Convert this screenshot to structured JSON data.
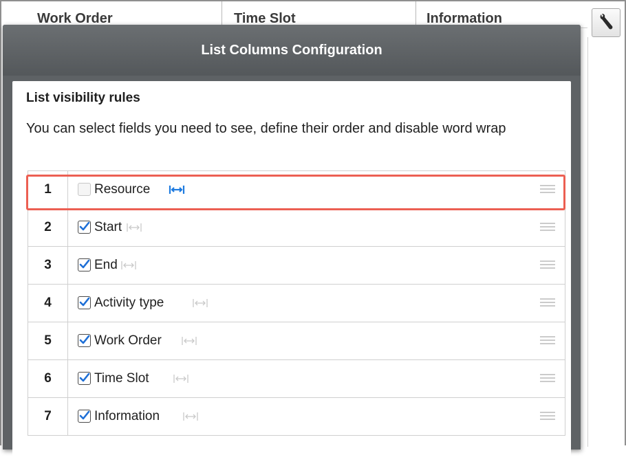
{
  "background_table": {
    "columns": [
      "Work Order",
      "Time Slot",
      "Information"
    ]
  },
  "dialog": {
    "title": "List Columns Configuration",
    "section_title": "List visibility rules",
    "description": "You can select fields you need to see, define their order and disable word wrap"
  },
  "rows": [
    {
      "number": "1",
      "label": "Resource",
      "checked": false,
      "wrap_active": true
    },
    {
      "number": "2",
      "label": "Start",
      "checked": true,
      "wrap_active": false
    },
    {
      "number": "3",
      "label": "End",
      "checked": true,
      "wrap_active": false
    },
    {
      "number": "4",
      "label": "Activity type",
      "checked": true,
      "wrap_active": false
    },
    {
      "number": "5",
      "label": "Work Order",
      "checked": true,
      "wrap_active": false
    },
    {
      "number": "6",
      "label": "Time Slot",
      "checked": true,
      "wrap_active": false
    },
    {
      "number": "7",
      "label": "Information",
      "checked": true,
      "wrap_active": false
    }
  ],
  "colors": {
    "highlight": "#ec5f52",
    "wrap_active": "#1e7be0",
    "wrap_inactive": "#c9c9c9",
    "dialog_header": "#5e6265"
  },
  "icons": {
    "settings": "wrench-icon",
    "word_wrap": "word-wrap-toggle-icon",
    "reorder": "drag-handle-icon"
  }
}
